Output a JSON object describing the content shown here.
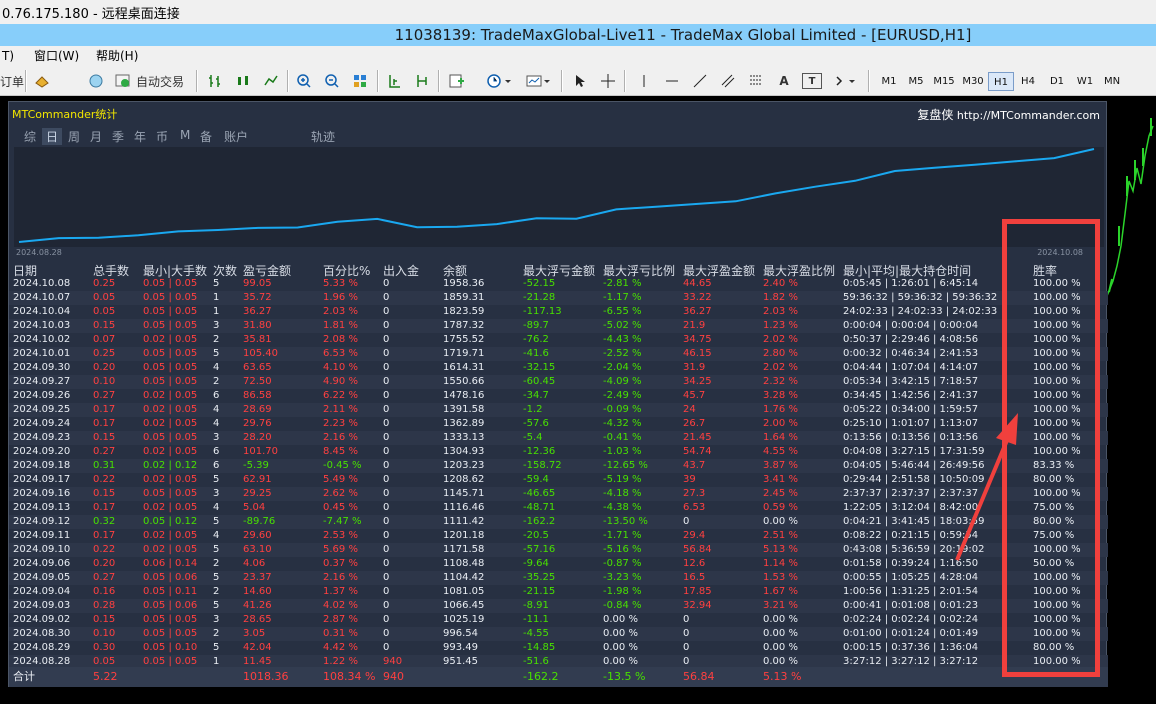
{
  "remote_bar": {
    "text": "0.76.175.180 - 远程桌面连接"
  },
  "title": "11038139: TradeMaxGlobal-Live11 - TradeMax Global Limited - [EURUSD,H1]",
  "menu": [
    "T)",
    "窗口(W)",
    "帮助(H)"
  ],
  "toolbar": {
    "order_label": "订单",
    "auto_trade_label": "自动交易",
    "icon_labels": [
      "A",
      "T"
    ],
    "timeframes": [
      "M1",
      "M5",
      "M15",
      "M30",
      "H1",
      "H4",
      "D1",
      "W1",
      "MN"
    ],
    "selected_timeframe": "H1"
  },
  "panel": {
    "title": "MTCommander统计",
    "brand_name": "复盘侠",
    "brand_url": "http://MTCommander.com",
    "tabs": [
      "综",
      "日",
      "周",
      "月",
      "季",
      "年",
      "币",
      "M",
      "备",
      "账户",
      "轨迹"
    ],
    "active_tab": "日",
    "date_start": "2024.08.28",
    "date_end": "2024.10.08",
    "headers": [
      "日期",
      "总手数",
      "最小|大手数",
      "次数",
      "盈亏金额",
      "百分比%",
      "出入金",
      "余额",
      "最大浮亏金额",
      "最大浮亏比例",
      "最大浮盈金额",
      "最大浮盈比例",
      "最小|平均|最大持仓时间",
      "胜率"
    ],
    "rows": [
      [
        "2024.10.08",
        "0.25",
        "0.05 | 0.05",
        "5",
        "99.05",
        "5.33 %",
        "0",
        "1958.36",
        "-52.15",
        "-2.81 %",
        "44.65",
        "2.40 %",
        "0:05:45 | 1:26:01 | 6:45:14",
        "100.00 %"
      ],
      [
        "2024.10.07",
        "0.05",
        "0.05 | 0.05",
        "1",
        "35.72",
        "1.96 %",
        "0",
        "1859.31",
        "-21.28",
        "-1.17 %",
        "33.22",
        "1.82 %",
        "59:36:32 | 59:36:32 | 59:36:32",
        "100.00 %"
      ],
      [
        "2024.10.04",
        "0.05",
        "0.05 | 0.05",
        "1",
        "36.27",
        "2.03 %",
        "0",
        "1823.59",
        "-117.13",
        "-6.55 %",
        "36.27",
        "2.03 %",
        "24:02:33 | 24:02:33 | 24:02:33",
        "100.00 %"
      ],
      [
        "2024.10.03",
        "0.15",
        "0.05 | 0.05",
        "3",
        "31.80",
        "1.81 %",
        "0",
        "1787.32",
        "-89.7",
        "-5.02 %",
        "21.9",
        "1.23 %",
        "0:00:04 | 0:00:04 | 0:00:04",
        "100.00 %"
      ],
      [
        "2024.10.02",
        "0.07",
        "0.02 | 0.05",
        "2",
        "35.81",
        "2.08 %",
        "0",
        "1755.52",
        "-76.2",
        "-4.43 %",
        "34.75",
        "2.02 %",
        "0:50:37 | 2:29:46 | 4:08:56",
        "100.00 %"
      ],
      [
        "2024.10.01",
        "0.25",
        "0.05 | 0.05",
        "5",
        "105.40",
        "6.53 %",
        "0",
        "1719.71",
        "-41.6",
        "-2.52 %",
        "46.15",
        "2.80 %",
        "0:00:32 | 0:46:34 | 2:41:53",
        "100.00 %"
      ],
      [
        "2024.09.30",
        "0.20",
        "0.05 | 0.05",
        "4",
        "63.65",
        "4.10 %",
        "0",
        "1614.31",
        "-32.15",
        "-2.04 %",
        "31.9",
        "2.02 %",
        "0:04:44 | 1:07:04 | 4:14:07",
        "100.00 %"
      ],
      [
        "2024.09.27",
        "0.10",
        "0.05 | 0.05",
        "2",
        "72.50",
        "4.90 %",
        "0",
        "1550.66",
        "-60.45",
        "-4.09 %",
        "34.25",
        "2.32 %",
        "0:05:34 | 3:42:15 | 7:18:57",
        "100.00 %"
      ],
      [
        "2024.09.26",
        "0.27",
        "0.02 | 0.05",
        "6",
        "86.58",
        "6.22 %",
        "0",
        "1478.16",
        "-34.7",
        "-2.49 %",
        "45.7",
        "3.28 %",
        "0:34:45 | 1:42:56 | 2:41:37",
        "100.00 %"
      ],
      [
        "2024.09.25",
        "0.17",
        "0.02 | 0.05",
        "4",
        "28.69",
        "2.11 %",
        "0",
        "1391.58",
        "-1.2",
        "-0.09 %",
        "24",
        "1.76 %",
        "0:05:22 | 0:34:00 | 1:59:57",
        "100.00 %"
      ],
      [
        "2024.09.24",
        "0.17",
        "0.02 | 0.05",
        "4",
        "29.76",
        "2.23 %",
        "0",
        "1362.89",
        "-57.6",
        "-4.32 %",
        "26.7",
        "2.00 %",
        "0:25:10 | 1:01:07 | 1:13:07",
        "100.00 %"
      ],
      [
        "2024.09.23",
        "0.15",
        "0.05 | 0.05",
        "3",
        "28.20",
        "2.16 %",
        "0",
        "1333.13",
        "-5.4",
        "-0.41 %",
        "21.45",
        "1.64 %",
        "0:13:56 | 0:13:56 | 0:13:56",
        "100.00 %"
      ],
      [
        "2024.09.20",
        "0.27",
        "0.02 | 0.05",
        "6",
        "101.70",
        "8.45 %",
        "0",
        "1304.93",
        "-12.36",
        "-1.03 %",
        "54.74",
        "4.55 %",
        "0:04:08 | 3:27:15 | 17:31:59",
        "100.00 %"
      ],
      [
        "2024.09.18",
        "0.31",
        "0.02 | 0.12",
        "6",
        "-5.39",
        "-0.45 %",
        "0",
        "1203.23",
        "-158.72",
        "-12.65 %",
        "43.7",
        "3.87 %",
        "0:04:05 | 5:46:44 | 26:49:56",
        "83.33 %"
      ],
      [
        "2024.09.17",
        "0.22",
        "0.02 | 0.05",
        "5",
        "62.91",
        "5.49 %",
        "0",
        "1208.62",
        "-59.4",
        "-5.19 %",
        "39",
        "3.41 %",
        "0:29:44 | 2:51:58 | 10:50:09",
        "80.00 %"
      ],
      [
        "2024.09.16",
        "0.15",
        "0.05 | 0.05",
        "3",
        "29.25",
        "2.62 %",
        "0",
        "1145.71",
        "-46.65",
        "-4.18 %",
        "27.3",
        "2.45 %",
        "2:37:37 | 2:37:37 | 2:37:37",
        "100.00 %"
      ],
      [
        "2024.09.13",
        "0.17",
        "0.02 | 0.05",
        "4",
        "5.04",
        "0.45 %",
        "0",
        "1116.46",
        "-48.71",
        "-4.38 %",
        "6.53",
        "0.59 %",
        "1:22:05 | 3:12:04 | 8:42:00",
        "75.00 %"
      ],
      [
        "2024.09.12",
        "0.32",
        "0.05 | 0.12",
        "5",
        "-89.76",
        "-7.47 %",
        "0",
        "1111.42",
        "-162.2",
        "-13.50 %",
        "0",
        "0.00 %",
        "0:04:21 | 3:41:45 | 18:03:59",
        "80.00 %"
      ],
      [
        "2024.09.11",
        "0.17",
        "0.02 | 0.05",
        "4",
        "29.60",
        "2.53 %",
        "0",
        "1201.18",
        "-20.5",
        "-1.71 %",
        "29.4",
        "2.51 %",
        "0:08:22 | 0:21:15 | 0:59:54",
        "75.00 %"
      ],
      [
        "2024.09.10",
        "0.22",
        "0.02 | 0.05",
        "5",
        "63.10",
        "5.69 %",
        "0",
        "1171.58",
        "-57.16",
        "-5.16 %",
        "56.84",
        "5.13 %",
        "0:43:08 | 5:36:59 | 20:19:02",
        "100.00 %"
      ],
      [
        "2024.09.06",
        "0.20",
        "0.06 | 0.14",
        "2",
        "4.06",
        "0.37 %",
        "0",
        "1108.48",
        "-9.64",
        "-0.87 %",
        "12.6",
        "1.14 %",
        "0:01:58 | 0:39:24 | 1:16:50",
        "50.00 %"
      ],
      [
        "2024.09.05",
        "0.27",
        "0.05 | 0.06",
        "5",
        "23.37",
        "2.16 %",
        "0",
        "1104.42",
        "-35.25",
        "-3.23 %",
        "16.5",
        "1.53 %",
        "0:00:55 | 1:05:25 | 4:28:04",
        "100.00 %"
      ],
      [
        "2024.09.04",
        "0.16",
        "0.05 | 0.11",
        "2",
        "14.60",
        "1.37 %",
        "0",
        "1081.05",
        "-21.15",
        "-1.98 %",
        "17.85",
        "1.67 %",
        "1:00:56 | 1:31:25 | 2:01:54",
        "100.00 %"
      ],
      [
        "2024.09.03",
        "0.28",
        "0.05 | 0.06",
        "5",
        "41.26",
        "4.02 %",
        "0",
        "1066.45",
        "-8.91",
        "-0.84 %",
        "32.94",
        "3.21 %",
        "0:00:41 | 0:01:08 | 0:01:23",
        "100.00 %"
      ],
      [
        "2024.09.02",
        "0.15",
        "0.05 | 0.05",
        "3",
        "28.65",
        "2.87 %",
        "0",
        "1025.19",
        "-11.1",
        "0.00 %",
        "0",
        "0.00 %",
        "0:02:24 | 0:02:24 | 0:02:24",
        "100.00 %"
      ],
      [
        "2024.08.30",
        "0.10",
        "0.05 | 0.05",
        "2",
        "3.05",
        "0.31 %",
        "0",
        "996.54",
        "-4.55",
        "0.00 %",
        "0",
        "0.00 %",
        "0:01:00 | 0:01:24 | 0:01:49",
        "100.00 %"
      ],
      [
        "2024.08.29",
        "0.30",
        "0.05 | 0.10",
        "5",
        "42.04",
        "4.42 %",
        "0",
        "993.49",
        "-14.85",
        "0.00 %",
        "0",
        "0.00 %",
        "0:00:15 | 0:37:36 | 1:36:04",
        "80.00 %"
      ],
      [
        "2024.08.28",
        "0.05",
        "0.05 | 0.05",
        "1",
        "11.45",
        "1.22 %",
        "940",
        "951.45",
        "-51.6",
        "0.00 %",
        "0",
        "0.00 %",
        "3:27:12 | 3:27:12 | 3:27:12",
        "100.00 %"
      ]
    ],
    "total": {
      "label": "合计",
      "lots": "5.22",
      "pnl": "1018.36",
      "pct": "108.34 %",
      "deposit": "940",
      "max_float_loss": "-162.2",
      "max_float_loss_pct": "-13.5 %",
      "max_float_profit": "56.84",
      "max_float_profit_pct": "5.13 %"
    },
    "equity_curve": [
      951.45,
      993.49,
      996.54,
      1025.19,
      1066.45,
      1081.05,
      1104.42,
      1108.48,
      1171.58,
      1201.18,
      1111.42,
      1116.46,
      1145.71,
      1208.62,
      1203.23,
      1304.93,
      1333.13,
      1362.89,
      1391.58,
      1478.16,
      1550.66,
      1614.31,
      1719.71,
      1755.52,
      1787.32,
      1823.59,
      1859.31,
      1958.36
    ]
  },
  "colors": {
    "panel_bg": "#273042",
    "profit": "#ff4040",
    "loss": "#48e000",
    "curve": "#1aa8f0",
    "highlight_box": "#f0403d",
    "title_bar": "#87cefa"
  }
}
